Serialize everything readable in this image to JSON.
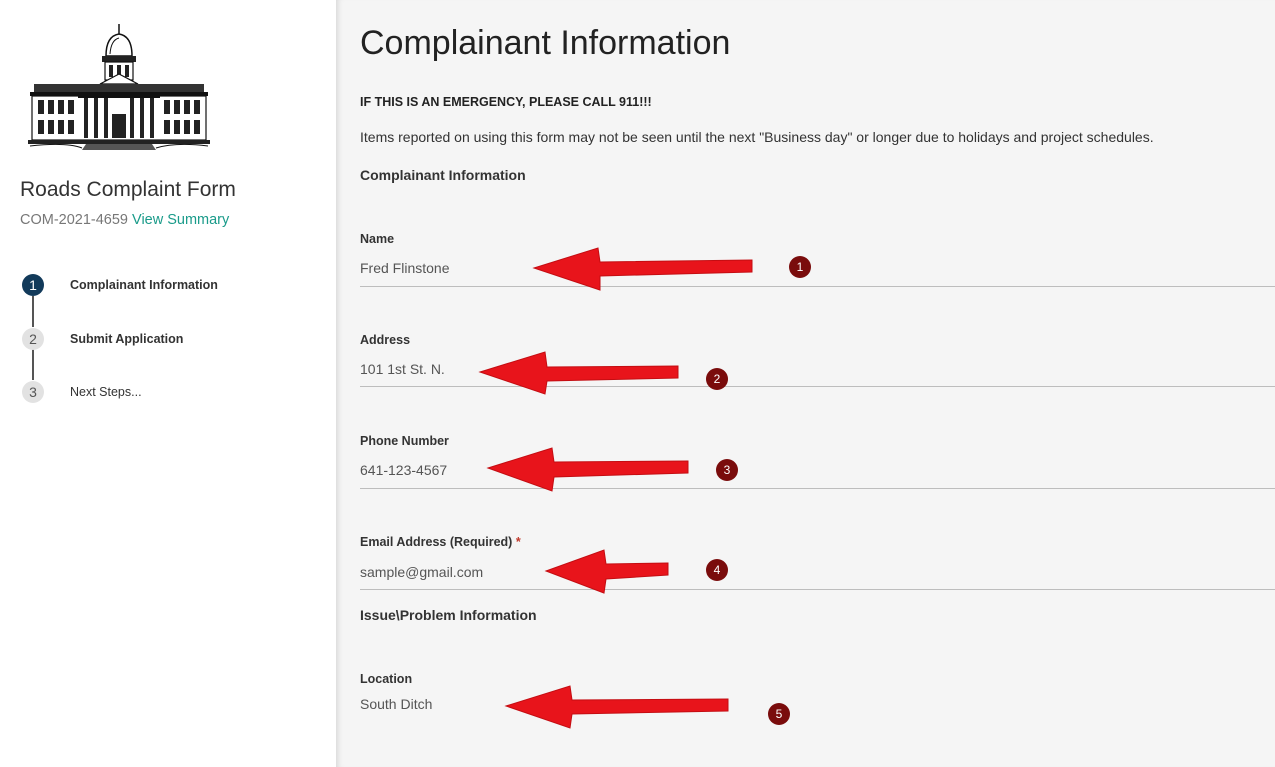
{
  "sidebar": {
    "form_title": "Roads Complaint Form",
    "record_number": "COM-2021-4659",
    "view_summary": "View Summary",
    "steps": [
      {
        "number": "1",
        "label": "Complainant Information",
        "state": "active"
      },
      {
        "number": "2",
        "label": "Submit Application",
        "state": "upcoming"
      },
      {
        "number": "3",
        "label": "Next Steps...",
        "state": "upcoming"
      }
    ]
  },
  "main": {
    "title": "Complainant Information",
    "emergency": "IF THIS IS AN EMERGENCY, PLEASE CALL 911!!!",
    "notice": "Items reported on using this form may not be seen until the next \"Business day\" or longer due to holidays and project schedules.",
    "section1": "Complainant Information",
    "section2": "Issue\\Problem Information",
    "fields": {
      "name": {
        "label": "Name",
        "value": "Fred Flinstone"
      },
      "address": {
        "label": "Address",
        "value": "101 1st St. N."
      },
      "phone": {
        "label": "Phone Number",
        "value": "641-123-4567"
      },
      "email": {
        "label": "Email Address (Required)",
        "required_mark": "*",
        "value": "sample@gmail.com"
      },
      "location": {
        "label": "Location",
        "value": "South Ditch"
      }
    }
  },
  "annotations": {
    "color": "#e8141b",
    "marker_color": "#7a0c0c",
    "markers": [
      "1",
      "2",
      "3",
      "4",
      "5"
    ]
  },
  "colors": {
    "accent": "#1a9b8a",
    "active_step": "#123a5a",
    "panel_bg": "#f5f5f5"
  }
}
